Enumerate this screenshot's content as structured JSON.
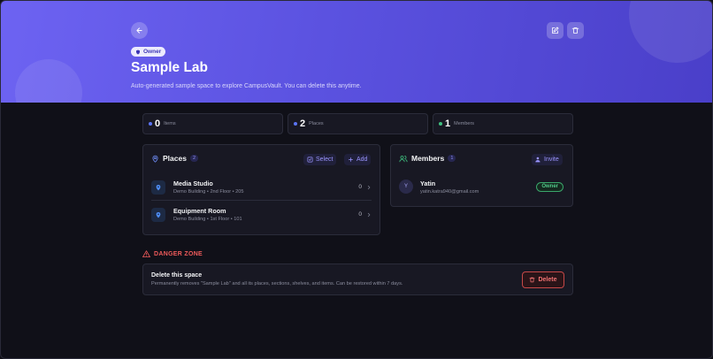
{
  "header": {
    "role_label": "Owner",
    "title": "Sample Lab",
    "subtitle": "Auto-generated sample space to explore CampusVault. You can delete this anytime."
  },
  "stats": [
    {
      "value": "0",
      "label": "Items",
      "color": "#5b74f5"
    },
    {
      "value": "2",
      "label": "Places",
      "color": "#5b74f5"
    },
    {
      "value": "1",
      "label": "Members",
      "color": "#3fbf7f"
    }
  ],
  "places": {
    "title": "Places",
    "count": "2",
    "select_label": "Select",
    "add_label": "Add",
    "items": [
      {
        "name": "Media Studio",
        "location": "Demo Building • 2nd Floor • 205",
        "count": "0"
      },
      {
        "name": "Equipment Room",
        "location": "Demo Building • 1st Floor • 101",
        "count": "0"
      }
    ]
  },
  "members": {
    "title": "Members",
    "count": "1",
    "invite_label": "Invite",
    "items": [
      {
        "initial": "Y",
        "name": "Yatin",
        "email": "yatin.katra940@gmail.com",
        "role": "Owner"
      }
    ]
  },
  "danger": {
    "heading": "DANGER ZONE",
    "title": "Delete this space",
    "description": "Permanently removes \"Sample Lab\" and all its places, sections, shelves, and items. Can be restored within 7 days.",
    "delete_label": "Delete"
  },
  "colors": {
    "accent": "#5b52e0",
    "danger": "#ef5a5a",
    "success": "#52c98a"
  }
}
